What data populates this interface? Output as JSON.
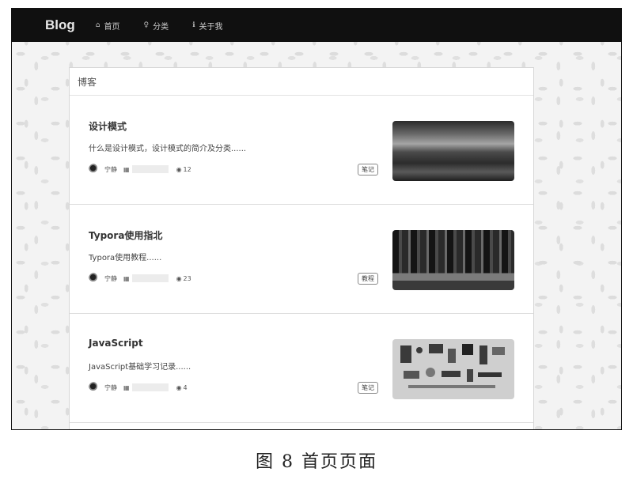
{
  "navbar": {
    "brand": "Blog",
    "items": [
      {
        "icon": "home-icon",
        "glyph": "⌂",
        "label": "首页"
      },
      {
        "icon": "lightbulb-icon",
        "glyph": "♀",
        "label": "分类"
      },
      {
        "icon": "info-icon",
        "glyph": "ℹ",
        "label": "关于我"
      }
    ]
  },
  "main": {
    "header": "博客",
    "posts": [
      {
        "title": "设计模式",
        "desc": "什么是设计模式，设计模式的简介及分类......",
        "author": "宁静",
        "views": "12",
        "tag": "笔记"
      },
      {
        "title": "Typora使用指北",
        "desc": "Typora使用教程......",
        "author": "宁静",
        "views": "23",
        "tag": "教程"
      },
      {
        "title": "JavaScript",
        "desc": "JavaScript基础学习记录......",
        "author": "宁静",
        "views": "4",
        "tag": "笔记"
      }
    ]
  },
  "caption": "图 8   首页页面"
}
